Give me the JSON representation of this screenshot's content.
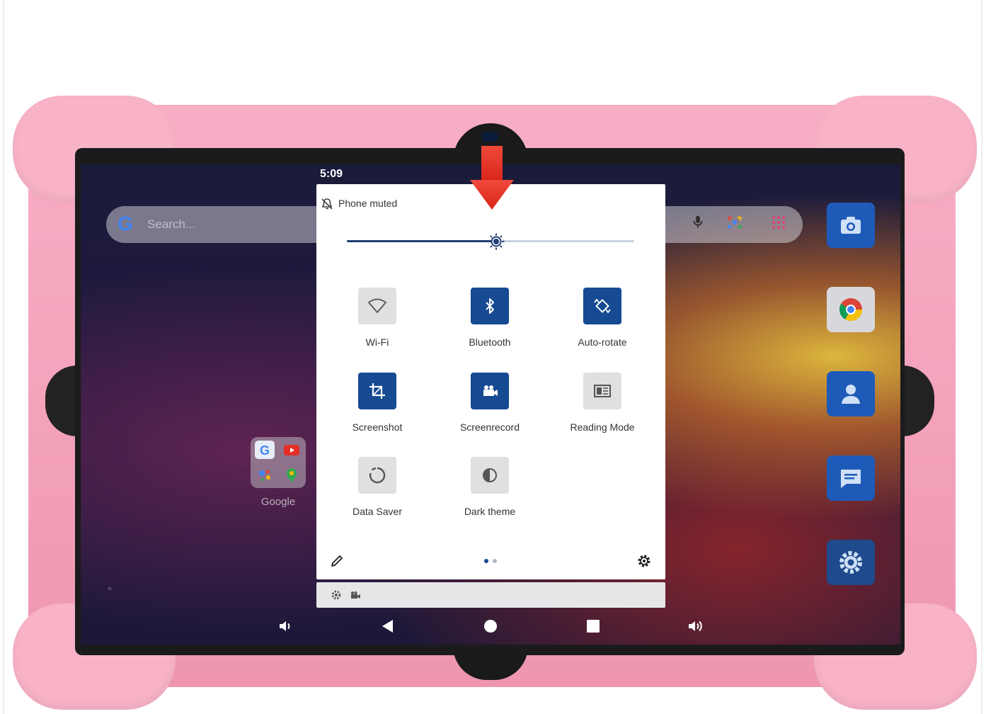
{
  "status_bar": {
    "time": "5:09"
  },
  "launcher": {
    "search_placeholder": "Search...",
    "search_logo": "G",
    "folder_label": "Google",
    "dock": [
      "camera-icon",
      "chrome-icon",
      "contacts-icon",
      "messages-icon",
      "settings-icon"
    ]
  },
  "quick_settings": {
    "ringer_label": "Phone muted",
    "brightness_level": 0.52,
    "tiles": [
      {
        "label": "Wi-Fi",
        "state": "off",
        "icon": "wifi-icon"
      },
      {
        "label": "Bluetooth",
        "state": "on",
        "icon": "bluetooth-icon"
      },
      {
        "label": "Auto-rotate",
        "state": "on",
        "icon": "auto-rotate-icon"
      },
      {
        "label": "Screenshot",
        "state": "on",
        "icon": "screenshot-icon"
      },
      {
        "label": "Screenrecord",
        "state": "on",
        "icon": "screenrecord-icon"
      },
      {
        "label": "Reading Mode",
        "state": "off",
        "icon": "reading-mode-icon"
      },
      {
        "label": "Data Saver",
        "state": "off",
        "icon": "data-saver-icon"
      },
      {
        "label": "Dark theme",
        "state": "off",
        "icon": "dark-theme-icon"
      }
    ],
    "page_count": 2,
    "current_page": 1
  },
  "colors": {
    "tile_on": "#164a92",
    "tile_off": "#e0e0e0",
    "case_pink": "#f4a3bb",
    "arrow_red": "#e8302a"
  }
}
